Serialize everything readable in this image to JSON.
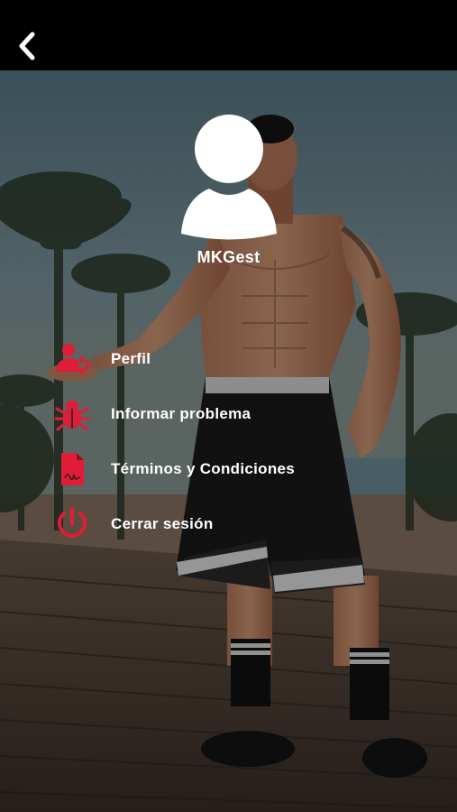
{
  "header": {
    "back_icon": "chevron-left-icon"
  },
  "profile": {
    "username": "MKGest",
    "avatar_icon": "user-silhouette-icon"
  },
  "menu": {
    "items": [
      {
        "label": "Perfil",
        "icon": "user-gear-icon"
      },
      {
        "label": "Informar problema",
        "icon": "bug-icon"
      },
      {
        "label": "Términos y Condiciones",
        "icon": "document-signature-icon"
      },
      {
        "label": "Cerrar sesión",
        "icon": "power-icon"
      }
    ]
  },
  "colors": {
    "accent": "#e01d38",
    "text": "#ffffff",
    "topbar": "#000000"
  }
}
